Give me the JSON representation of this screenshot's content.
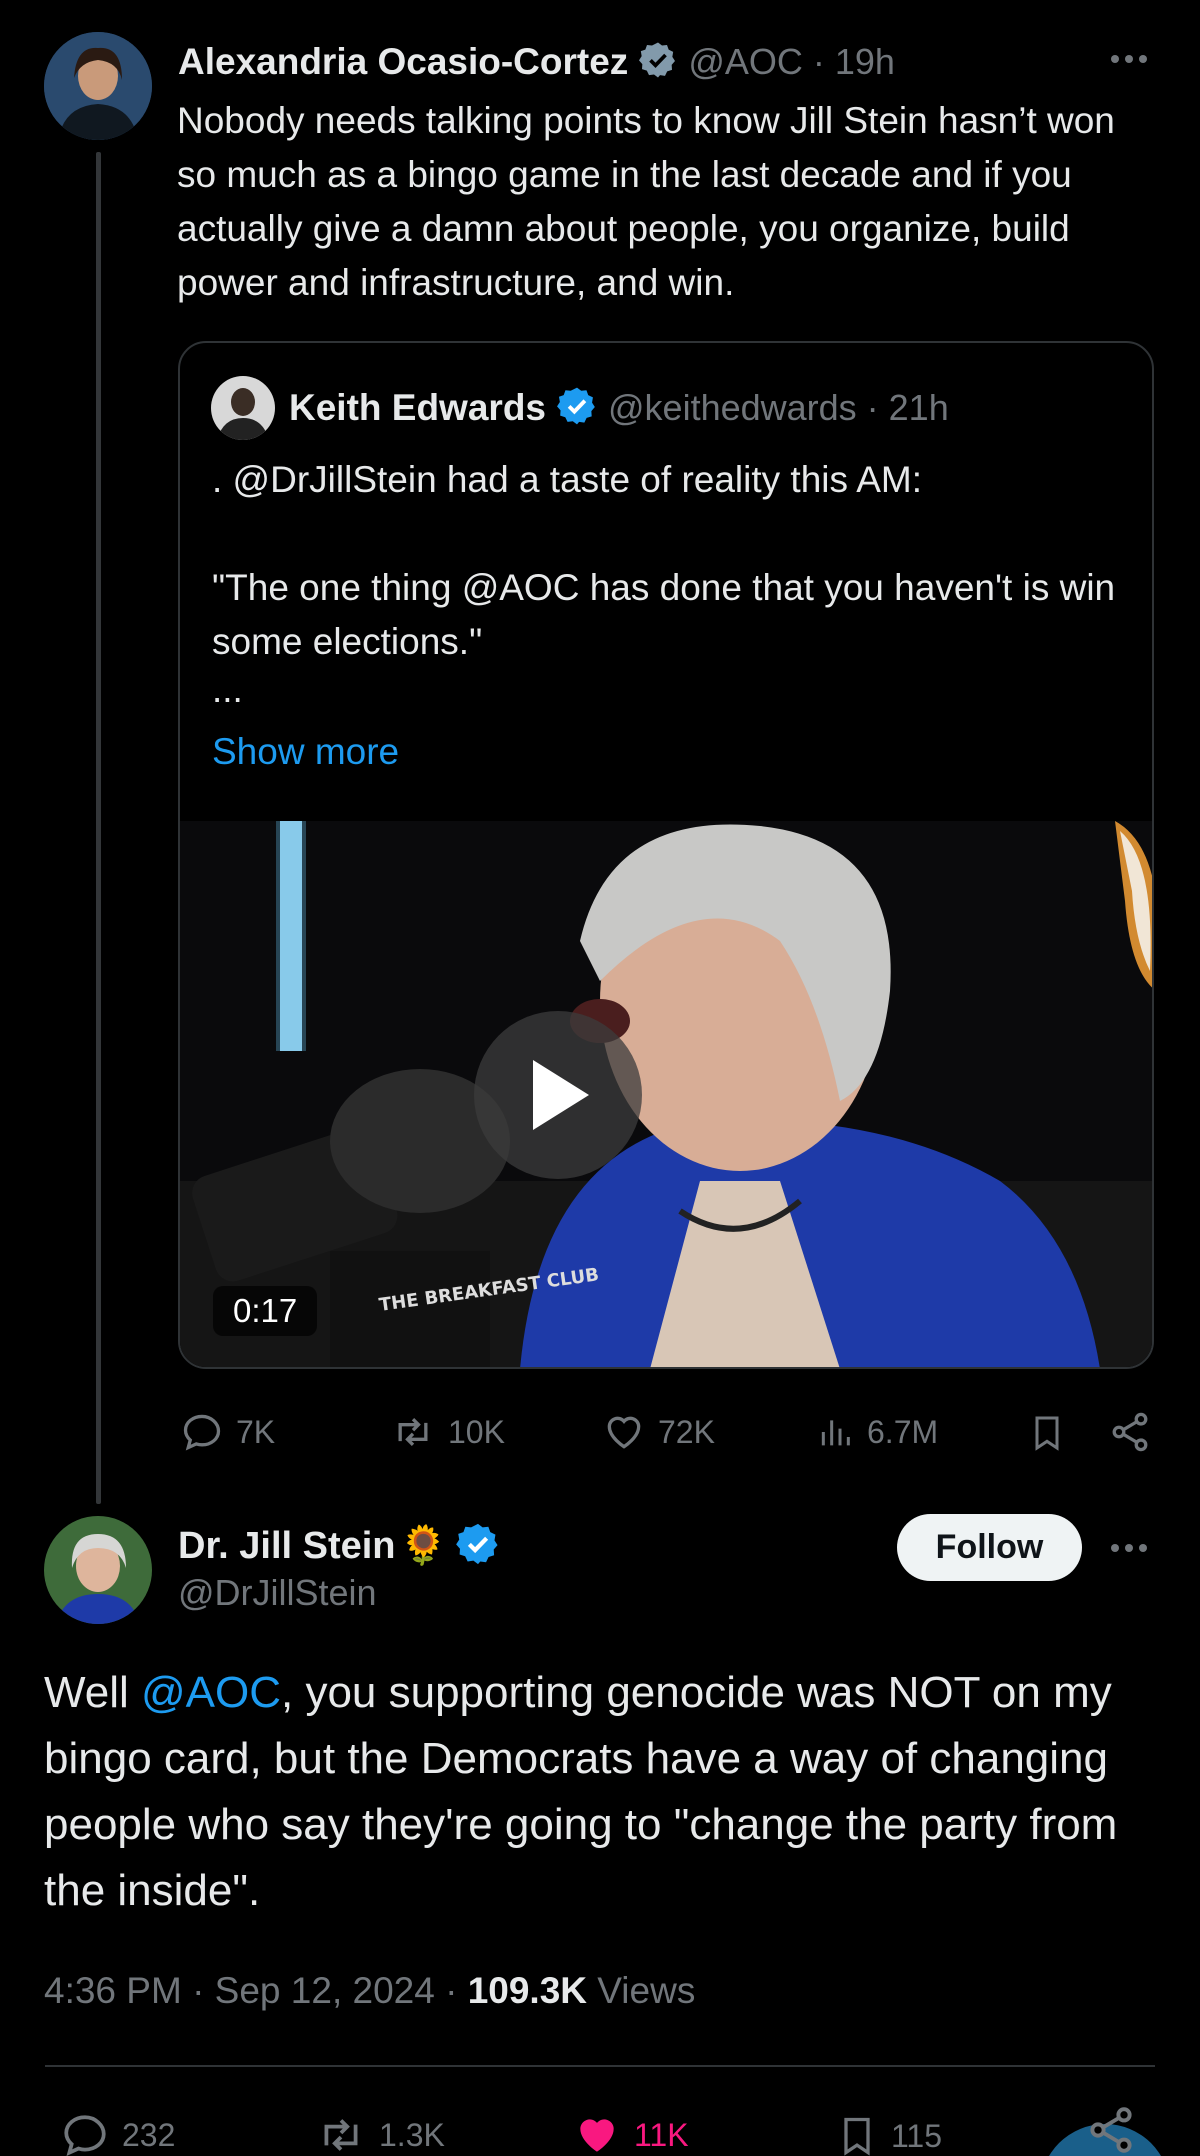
{
  "aoc_tweet": {
    "display_name": "Alexandria Ocasio-Cortez",
    "handle": "@AOC",
    "time": "· 19h",
    "text": "Nobody needs talking points to know Jill Stein hasn’t won so much as a bingo game in the last decade and if you actually give a damn about people, you organize, build power and infrastructure, and win.",
    "quote": {
      "display_name": "Keith Edwards",
      "handle": "@keithedwards",
      "time": "· 21h",
      "line1": ". @DrJillStein had a taste of reality this AM:",
      "line2": "\"The one thing @AOC has done that you haven't is win some elections.\"",
      "ellipsis": "...",
      "show_more": "Show more",
      "video_duration": "0:17"
    },
    "actions": {
      "replies": "7K",
      "reposts": "10K",
      "likes": "72K",
      "views": "6.7M"
    }
  },
  "stein_tweet": {
    "display_name": "Dr. Jill Stein",
    "emoji": "🌻",
    "handle": "@DrJillStein",
    "follow_label": "Follow",
    "text_mention": "@AOC",
    "text_before": "Well ",
    "text_after": ", you supporting genocide was NOT on my bingo card, but the Democrats have a way of changing people who say they're going to \"change the party from the inside\".",
    "timestamp": "4:36 PM · Sep 12, 2024 · ",
    "views_count": "109.3K",
    "views_label": " Views",
    "actions": {
      "replies": "232",
      "reposts": "1.3K",
      "likes": "11K",
      "bookmarks": "115"
    }
  },
  "colors": {
    "background": "#000000",
    "text": "#e7e9ea",
    "muted": "#71767b",
    "accent_blue": "#1d9bf0",
    "like_pink": "#f91880"
  }
}
